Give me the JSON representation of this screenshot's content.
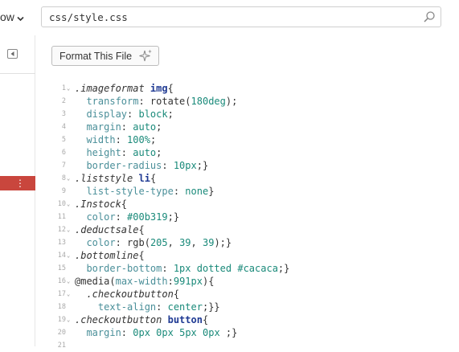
{
  "header": {
    "view_menu_label": "ow",
    "file_path": "css/style.css"
  },
  "toolbar": {
    "format_label": "Format This File"
  },
  "editor": {
    "lines": [
      {
        "num": "1",
        "fold": "⌄",
        "tokens": [
          {
            "t": ".imageformat ",
            "c": "t-sel"
          },
          {
            "t": "img",
            "c": "t-tag"
          },
          {
            "t": "{",
            "c": "t-pun"
          }
        ]
      },
      {
        "num": "2",
        "fold": "",
        "tokens": [
          {
            "t": "  transform",
            "c": "t-prop"
          },
          {
            "t": ": rotate(",
            "c": "t-val"
          },
          {
            "t": "180deg",
            "c": "t-num"
          },
          {
            "t": ");",
            "c": "t-pun"
          }
        ]
      },
      {
        "num": "3",
        "fold": "",
        "tokens": [
          {
            "t": "  display",
            "c": "t-prop"
          },
          {
            "t": ": ",
            "c": "t-val"
          },
          {
            "t": "block",
            "c": "t-num"
          },
          {
            "t": ";",
            "c": "t-pun"
          }
        ]
      },
      {
        "num": "4",
        "fold": "",
        "tokens": [
          {
            "t": "  margin",
            "c": "t-prop"
          },
          {
            "t": ": ",
            "c": "t-val"
          },
          {
            "t": "auto",
            "c": "t-num"
          },
          {
            "t": ";",
            "c": "t-pun"
          }
        ]
      },
      {
        "num": "5",
        "fold": "",
        "tokens": [
          {
            "t": "  width",
            "c": "t-prop"
          },
          {
            "t": ": ",
            "c": "t-val"
          },
          {
            "t": "100%",
            "c": "t-num"
          },
          {
            "t": ";",
            "c": "t-pun"
          }
        ]
      },
      {
        "num": "6",
        "fold": "",
        "tokens": [
          {
            "t": "  height",
            "c": "t-prop"
          },
          {
            "t": ": ",
            "c": "t-val"
          },
          {
            "t": "auto",
            "c": "t-num"
          },
          {
            "t": ";",
            "c": "t-pun"
          }
        ]
      },
      {
        "num": "7",
        "fold": "",
        "tokens": [
          {
            "t": "  border-radius",
            "c": "t-prop"
          },
          {
            "t": ": ",
            "c": "t-val"
          },
          {
            "t": "10px",
            "c": "t-num"
          },
          {
            "t": ";}",
            "c": "t-pun"
          }
        ]
      },
      {
        "num": "8",
        "fold": "⌄",
        "tokens": [
          {
            "t": ".liststyle ",
            "c": "t-sel"
          },
          {
            "t": "li",
            "c": "t-tag"
          },
          {
            "t": "{",
            "c": "t-pun"
          }
        ]
      },
      {
        "num": "9",
        "fold": "",
        "tokens": [
          {
            "t": "  list-style-type",
            "c": "t-prop"
          },
          {
            "t": ": ",
            "c": "t-val"
          },
          {
            "t": "none",
            "c": "t-num"
          },
          {
            "t": "}",
            "c": "t-pun"
          }
        ]
      },
      {
        "num": "10",
        "fold": "⌄",
        "tokens": [
          {
            "t": ".Instock",
            "c": "t-sel"
          },
          {
            "t": "{",
            "c": "t-pun"
          }
        ]
      },
      {
        "num": "11",
        "fold": "",
        "tokens": [
          {
            "t": "  color",
            "c": "t-prop"
          },
          {
            "t": ": ",
            "c": "t-val"
          },
          {
            "t": "#00b319",
            "c": "t-col"
          },
          {
            "t": ";}",
            "c": "t-pun"
          }
        ]
      },
      {
        "num": "12",
        "fold": "⌄",
        "tokens": [
          {
            "t": ".deductsale",
            "c": "t-sel"
          },
          {
            "t": "{",
            "c": "t-pun"
          }
        ]
      },
      {
        "num": "13",
        "fold": "",
        "tokens": [
          {
            "t": "  color",
            "c": "t-prop"
          },
          {
            "t": ": rgb(",
            "c": "t-val"
          },
          {
            "t": "205",
            "c": "t-num"
          },
          {
            "t": ", ",
            "c": "t-pun"
          },
          {
            "t": "39",
            "c": "t-num"
          },
          {
            "t": ", ",
            "c": "t-pun"
          },
          {
            "t": "39",
            "c": "t-num"
          },
          {
            "t": ");}",
            "c": "t-pun"
          }
        ]
      },
      {
        "num": "14",
        "fold": "⌄",
        "tokens": [
          {
            "t": ".bottomline",
            "c": "t-sel"
          },
          {
            "t": "{",
            "c": "t-pun"
          }
        ]
      },
      {
        "num": "15",
        "fold": "",
        "tokens": [
          {
            "t": "  border-bottom",
            "c": "t-prop"
          },
          {
            "t": ": ",
            "c": "t-val"
          },
          {
            "t": "1px",
            "c": "t-num"
          },
          {
            "t": " ",
            "c": "t-val"
          },
          {
            "t": "dotted",
            "c": "t-num"
          },
          {
            "t": " ",
            "c": "t-val"
          },
          {
            "t": "#cacaca",
            "c": "t-col"
          },
          {
            "t": ";}",
            "c": "t-pun"
          }
        ]
      },
      {
        "num": "16",
        "fold": "⌄",
        "tokens": [
          {
            "t": "@media",
            "c": "t-at"
          },
          {
            "t": "(",
            "c": "t-pun"
          },
          {
            "t": "max-width",
            "c": "t-prop"
          },
          {
            "t": ":",
            "c": "t-pun"
          },
          {
            "t": "991px",
            "c": "t-num"
          },
          {
            "t": "){",
            "c": "t-pun"
          }
        ]
      },
      {
        "num": "17",
        "fold": "⌄",
        "tokens": [
          {
            "t": "  .checkoutbutton",
            "c": "t-sel"
          },
          {
            "t": "{",
            "c": "t-pun"
          }
        ]
      },
      {
        "num": "18",
        "fold": "",
        "tokens": [
          {
            "t": "    text-align",
            "c": "t-prop"
          },
          {
            "t": ": ",
            "c": "t-val"
          },
          {
            "t": "center",
            "c": "t-num"
          },
          {
            "t": ";}}",
            "c": "t-pun"
          }
        ]
      },
      {
        "num": "19",
        "fold": "⌄",
        "tokens": [
          {
            "t": ".checkoutbutton ",
            "c": "t-sel"
          },
          {
            "t": "button",
            "c": "t-tag"
          },
          {
            "t": "{",
            "c": "t-pun"
          }
        ]
      },
      {
        "num": "20",
        "fold": "",
        "tokens": [
          {
            "t": "  margin",
            "c": "t-prop"
          },
          {
            "t": ": ",
            "c": "t-val"
          },
          {
            "t": "0px",
            "c": "t-num"
          },
          {
            "t": " ",
            "c": "t-val"
          },
          {
            "t": "0px",
            "c": "t-num"
          },
          {
            "t": " ",
            "c": "t-val"
          },
          {
            "t": "5px",
            "c": "t-num"
          },
          {
            "t": " ",
            "c": "t-val"
          },
          {
            "t": "0px",
            "c": "t-num"
          },
          {
            "t": " ;}",
            "c": "t-pun"
          }
        ]
      },
      {
        "num": "21",
        "fold": "",
        "tokens": []
      }
    ]
  },
  "icons": {
    "view_chevron": "chevron-down-icon",
    "search": "search-icon",
    "collapse": "collapse-sidebar-icon",
    "more": "more-vertical-icon",
    "sparkle": "sparkle-icon"
  },
  "colors": {
    "accent_sidebar": "#c9463d",
    "selector": "#333333",
    "tag": "#1f3a93",
    "property": "#4a8f99",
    "value": "#1a8a7a"
  }
}
